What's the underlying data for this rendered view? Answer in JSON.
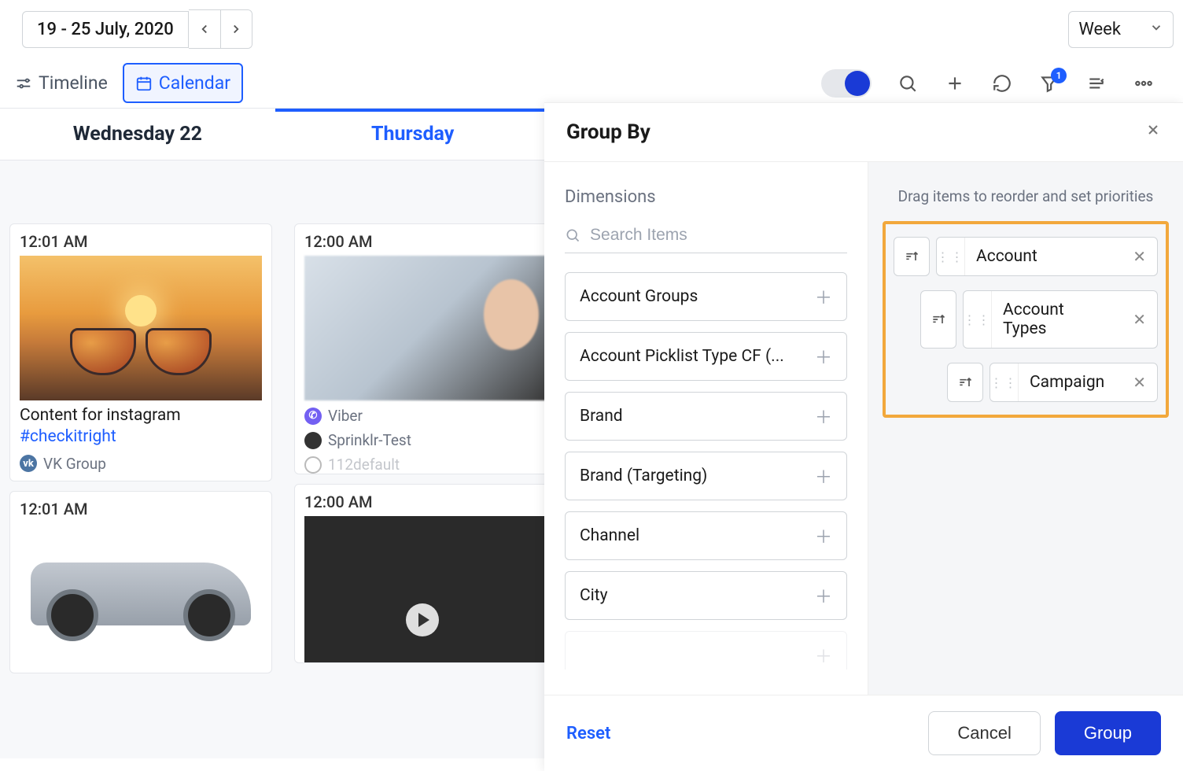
{
  "topbar": {
    "date_range": "19 - 25 July, 2020",
    "view_label": "Week"
  },
  "view_tabs": {
    "timeline": "Timeline",
    "calendar": "Calendar"
  },
  "toolbar": {
    "filter_badge": "1"
  },
  "day_tabs": {
    "wed": "Wednesday 22",
    "thu": "Thursday "
  },
  "cards": {
    "col1": {
      "c1": {
        "time": "12:01 AM",
        "text": "Content for instagram",
        "hashtag": "#checkitright",
        "source": "VK Group"
      },
      "c2": {
        "time": "12:01 AM"
      }
    },
    "col2": {
      "c1": {
        "time": "12:00 AM",
        "source1": "Viber",
        "source2": "Sprinklr-Test",
        "source3": "112default"
      },
      "c2": {
        "time": "12:00 AM"
      }
    }
  },
  "panel": {
    "title": "Group By",
    "left": {
      "label": "Dimensions",
      "search_placeholder": "Search Items",
      "items": [
        "Account Groups",
        "Account Picklist Type CF (...",
        "Brand",
        "Brand (Targeting)",
        "Channel",
        "City"
      ]
    },
    "right": {
      "hint": "Drag items to reorder and set priorities",
      "chips": [
        "Account",
        "Account Types",
        "Campaign"
      ]
    },
    "footer": {
      "reset": "Reset",
      "cancel": "Cancel",
      "group": "Group"
    }
  }
}
